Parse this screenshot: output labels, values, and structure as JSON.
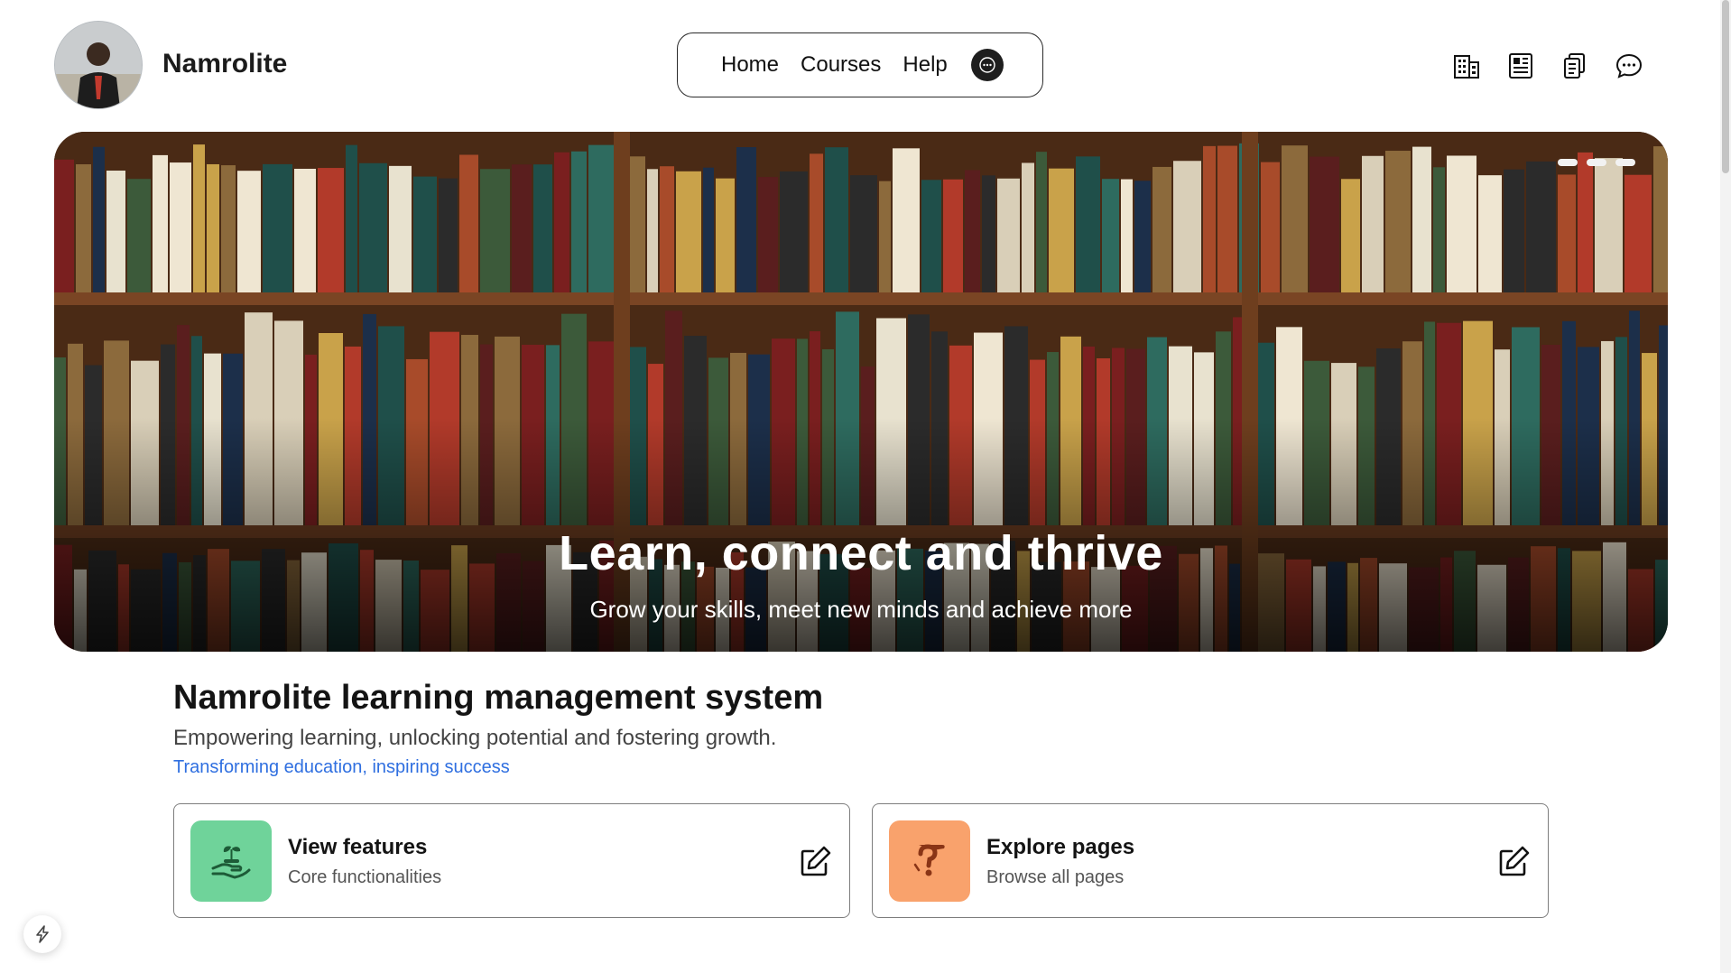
{
  "header": {
    "brand": "Namrolite",
    "nav": [
      "Home",
      "Courses",
      "Help"
    ],
    "icons": [
      "building-icon",
      "newspaper-icon",
      "clipboard-icon",
      "chat-icon"
    ]
  },
  "hero": {
    "title": "Learn, connect and thrive",
    "subtitle": "Grow your skills, meet new minds and achieve more",
    "slides": 3
  },
  "intro": {
    "title": "Namrolite learning management system",
    "subtitle": "Empowering learning, unlocking potential and fostering growth.",
    "link": "Transforming education, inspiring success"
  },
  "cards": [
    {
      "title": "View features",
      "subtitle": "Core functionalities",
      "accent": "#6fd39a",
      "icon": "plant-hand-icon"
    },
    {
      "title": "Explore pages",
      "subtitle": "Browse all pages",
      "accent": "#f9a26c",
      "icon": "question-hand-icon"
    }
  ],
  "colors": {
    "link": "#2f6fe0",
    "hero_bg": "#3a2213"
  }
}
